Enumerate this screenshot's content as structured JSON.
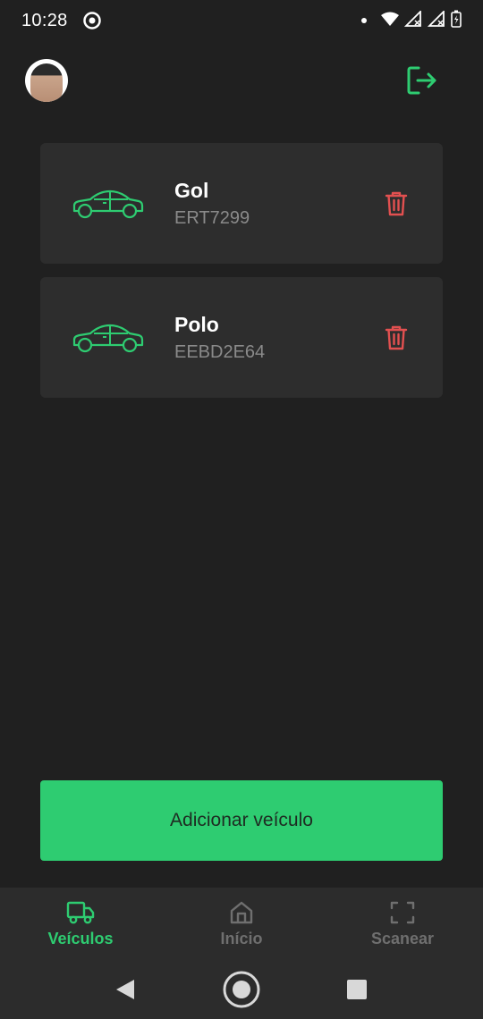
{
  "status_bar": {
    "time": "10:28"
  },
  "vehicles": [
    {
      "name": "Gol",
      "plate": "ERT7299"
    },
    {
      "name": "Polo",
      "plate": "EEBD2E64"
    }
  ],
  "add_button": {
    "label": "Adicionar veículo"
  },
  "bottom_nav": {
    "items": [
      {
        "label": "Veículos",
        "icon": "truck-icon",
        "active": true
      },
      {
        "label": "Início",
        "icon": "home-icon",
        "active": false
      },
      {
        "label": "Scanear",
        "icon": "scan-icon",
        "active": false
      }
    ]
  },
  "colors": {
    "background": "#202020",
    "card": "#2d2d2d",
    "accent_green": "#2ecc71",
    "delete_red": "#e25050",
    "muted_text": "#8a8a8a"
  },
  "icons": {
    "logout": "logout-icon",
    "car": "car-icon",
    "delete": "trash-icon"
  }
}
